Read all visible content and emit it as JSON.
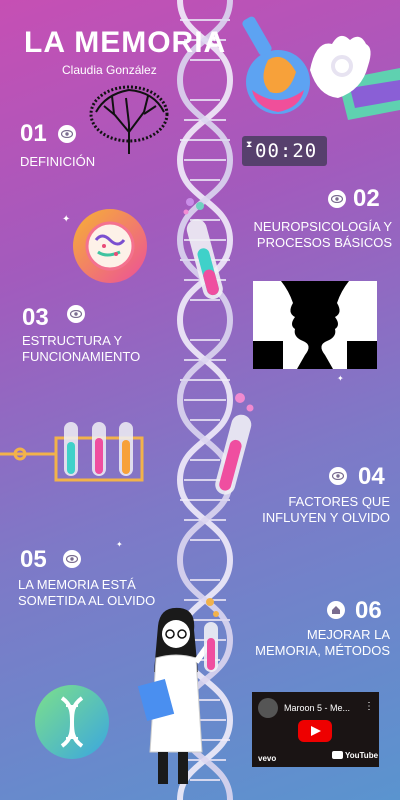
{
  "title": "LA MEMORIA",
  "subtitle": "Claudia González",
  "timer": "00:20",
  "sections": [
    {
      "num": "01",
      "label": "DEFINICIÓN"
    },
    {
      "num": "02",
      "label_line1": "NEUROPSICOLOGÍA Y",
      "label_line2": "PROCESOS BÁSICOS"
    },
    {
      "num": "03",
      "label_line1": "ESTRUCTURA Y",
      "label_line2": "FUNCIONAMIENTO"
    },
    {
      "num": "04",
      "label_line1": "FACTORES QUE",
      "label_line2": "INFLUYEN Y OLVIDO"
    },
    {
      "num": "05",
      "label_line1": "LA MEMORIA ESTÁ",
      "label_line2": "SOMETIDA AL OLVIDO"
    },
    {
      "num": "06",
      "label_line1": "MEJORAR LA",
      "label_line2": "MEMORIA, MÉTODOS"
    }
  ],
  "video": {
    "title": "Maroon 5 - Me...",
    "brand_left": "vevo",
    "brand_right": "YouTube"
  },
  "colors": {
    "bg_top": "#c64fb4",
    "bg_bottom": "#5a94cf",
    "timer_bg": "#57406d"
  }
}
